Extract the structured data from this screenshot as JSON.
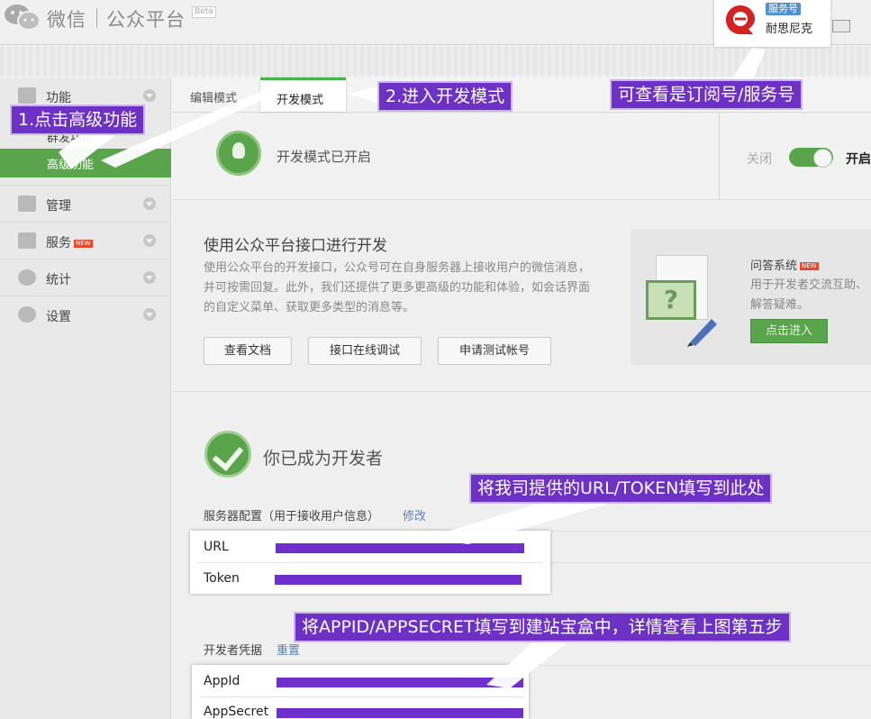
{
  "header": {
    "logo_text": "微信",
    "title": "公众平台",
    "beta": "Beta",
    "account_badge": "服务号",
    "account_name": "耐思尼克"
  },
  "sidebar": {
    "items": [
      {
        "label": "功能",
        "icon": "grid-icon"
      },
      {
        "label": "管理",
        "icon": "inbox-icon"
      },
      {
        "label": "服务",
        "icon": "shop-icon",
        "badge": "NEW"
      },
      {
        "label": "统计",
        "icon": "pie-chart-icon"
      },
      {
        "label": "设置",
        "icon": "gear-icon"
      }
    ],
    "sub_items": [
      "群发功能",
      "高级功能"
    ]
  },
  "tabs": {
    "edit": "编辑模式",
    "dev": "开发模式"
  },
  "status": {
    "text": "开发模式已开启",
    "off": "关闭",
    "on": "开启"
  },
  "api": {
    "title": "使用公众平台接口进行开发",
    "desc": "使用公众平台的开发接口，公众号可在自身服务器上接收用户的微信消息，并可按需回复。此外，我们还提供了更多更高级的功能和体验，如会话界面的自定义菜单、获取更多类型的消息等。",
    "buttons": [
      "查看文档",
      "接口在线调试",
      "申请测试帐号"
    ]
  },
  "qa": {
    "title": "问答系统",
    "badge": "NEW",
    "desc": "用于开发者交流互助、解答疑难。",
    "button": "点击进入"
  },
  "developer": {
    "title": "你已成为开发者",
    "server_label": "服务器配置（用于接收用户信息）",
    "server_edit": "修改",
    "url_label": "URL",
    "token_label": "Token",
    "cred_label": "开发者凭据",
    "cred_reset": "重置",
    "appid_label": "AppId",
    "appsecret_label": "AppSecret"
  },
  "callouts": {
    "step1": "1.点击高级功能",
    "step2": "2.进入开发模式",
    "account_type": "可查看是订阅号/服务号",
    "url_token": "将我司提供的URL/TOKEN填写到此处",
    "appid": "将APPID/APPSECRET填写到建站宝盒中，详情查看上图第五步"
  },
  "colors": {
    "accent_green": "#5aa44c",
    "callout_purple": "#6e31c6",
    "link_blue": "#5882b9"
  }
}
